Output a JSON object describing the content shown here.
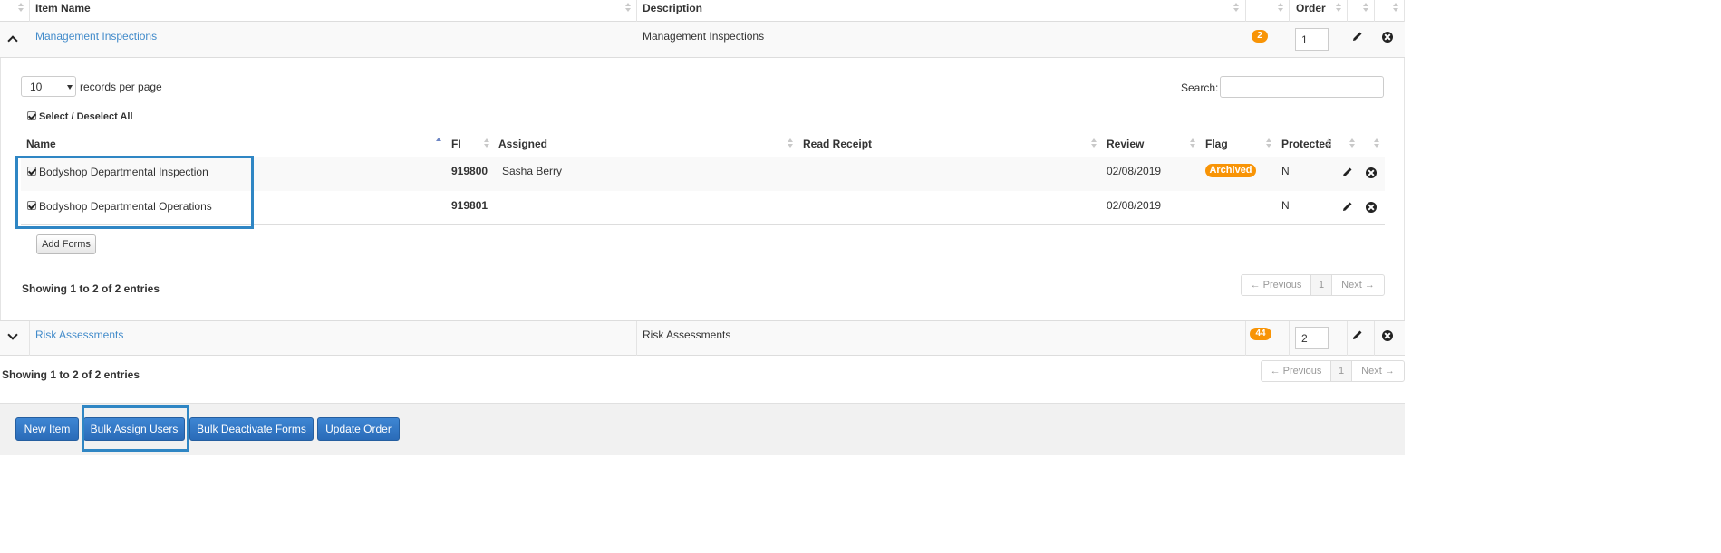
{
  "outer_table": {
    "headers": {
      "item_name": "Item Name",
      "description": "Description",
      "order": "Order"
    },
    "rows": [
      {
        "name": "Management Inspections",
        "description": "Management Inspections",
        "count": "2",
        "order": "1",
        "expanded": true
      },
      {
        "name": "Risk Assessments",
        "description": "Risk Assessments",
        "count": "44",
        "order": "2",
        "expanded": false
      }
    ],
    "footer_info": "Showing 1 to 2 of 2 entries",
    "pager": {
      "previous": "← Previous",
      "page": "1",
      "next": "Next →"
    }
  },
  "inner_table": {
    "page_length": "10",
    "page_length_label": "records per page",
    "search_label": "Search:",
    "search_value": "",
    "select_all_label": "Select / Deselect All",
    "headers": {
      "name": "Name",
      "fi": "FI",
      "assigned": "Assigned",
      "read_receipt": "Read Receipt",
      "review": "Review",
      "flag": "Flag",
      "protected": "Protected"
    },
    "rows": [
      {
        "name": "Bodyshop Departmental Inspection",
        "fi": "919800",
        "assigned": "Sasha Berry",
        "review": "02/08/2019",
        "flag": "Archived",
        "protected": "N",
        "checked": true
      },
      {
        "name": "Bodyshop Departmental Operations",
        "fi": "919801",
        "assigned": "",
        "review": "02/08/2019",
        "flag": "",
        "protected": "N",
        "checked": true
      }
    ],
    "add_forms_label": "Add Forms",
    "footer_info": "Showing 1 to 2 of 2 entries",
    "pager": {
      "previous": "← Previous",
      "page": "1",
      "next": "Next →"
    }
  },
  "actions": {
    "new_item": "New Item",
    "bulk_assign_users": "Bulk Assign Users",
    "bulk_deactivate_forms": "Bulk Deactivate Forms",
    "update_order": "Update Order"
  },
  "colors": {
    "link": "#428bca",
    "badge": "#f89406",
    "highlight": "#2f86c4",
    "button": "#2f74c0"
  }
}
